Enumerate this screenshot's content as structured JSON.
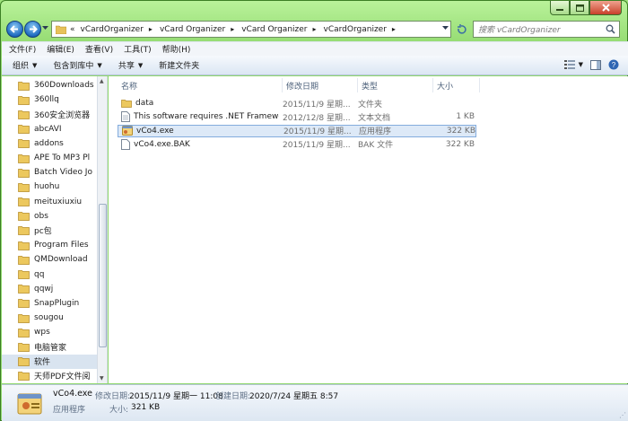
{
  "address": {
    "overflow_glyph": "«",
    "crumbs": [
      "vCardOrganizer",
      "vCard Organizer",
      "vCard Organizer",
      "vCardOrganizer"
    ],
    "search_placeholder": "搜索 vCardOrganizer"
  },
  "menu": [
    "文件(F)",
    "编辑(E)",
    "查看(V)",
    "工具(T)",
    "帮助(H)"
  ],
  "toolbar": {
    "organize": "组织",
    "include_library": "包含到库中",
    "share": "共享",
    "new_folder": "新建文件夹"
  },
  "nav_items": [
    {
      "label": "360Downloads"
    },
    {
      "label": "360llq"
    },
    {
      "label": "360安全浏览器"
    },
    {
      "label": "abcAVI"
    },
    {
      "label": "addons"
    },
    {
      "label": "APE To MP3 Pl"
    },
    {
      "label": "Batch Video Jo"
    },
    {
      "label": "huohu"
    },
    {
      "label": "meituxiuxiu"
    },
    {
      "label": "obs"
    },
    {
      "label": "pc包"
    },
    {
      "label": "Program Files"
    },
    {
      "label": "QMDownload"
    },
    {
      "label": "qq"
    },
    {
      "label": "qqwj"
    },
    {
      "label": "SnapPlugin"
    },
    {
      "label": "sougou"
    },
    {
      "label": "wps"
    },
    {
      "label": "电脑管家"
    },
    {
      "label": "软件",
      "selected": true
    },
    {
      "label": "天师PDF文件阅"
    }
  ],
  "columns": {
    "name": "名称",
    "date": "修改日期",
    "type": "类型",
    "size": "大小"
  },
  "files": [
    {
      "name": "data",
      "date": "2015/11/9 星期...",
      "type": "文件夹",
      "size": "",
      "icon": "folder-icon"
    },
    {
      "name": "This software requires .NET Framewo...",
      "date": "2012/12/8 星期...",
      "type": "文本文档",
      "size": "1 KB",
      "icon": "text-file-icon"
    },
    {
      "name": "vCo4.exe",
      "date": "2015/11/9 星期...",
      "type": "应用程序",
      "size": "322 KB",
      "icon": "exe-file-icon",
      "selected": true
    },
    {
      "name": "vCo4.exe.BAK",
      "date": "2015/11/9 星期...",
      "type": "BAK 文件",
      "size": "322 KB",
      "icon": "bak-file-icon"
    }
  ],
  "details": {
    "name": "vCo4.exe",
    "modified_label": "修改日期:",
    "modified_value": "2015/11/9 星期一 11:08",
    "created_label": "创建日期:",
    "created_value": "2020/7/24 星期五 8:57",
    "type": "应用程序",
    "size_label": "大小:",
    "size_value": "321 KB"
  },
  "colors": {
    "window_frame": "#8fd86c",
    "selection": "#dde9f7",
    "toolbar": "#dbe6f3"
  }
}
